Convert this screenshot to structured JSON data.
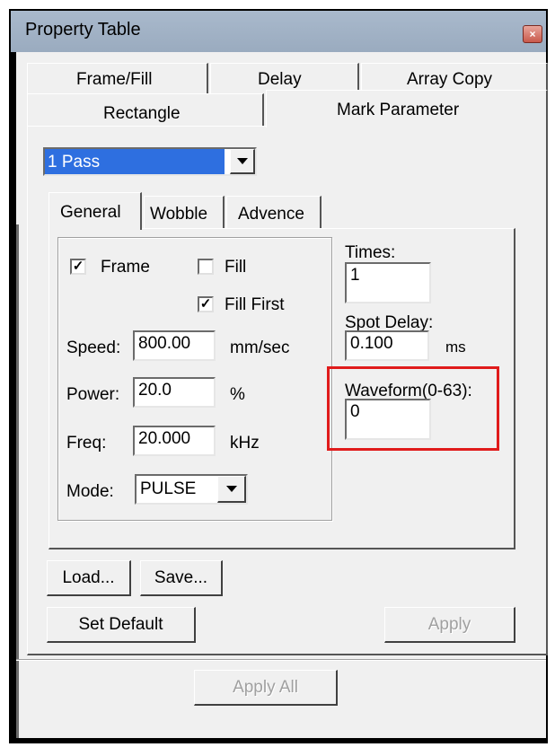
{
  "window": {
    "title": "Property Table",
    "close_glyph": "×"
  },
  "tabs_row1": [
    "Frame/Fill",
    "Delay",
    "Array Copy"
  ],
  "tabs_row2": [
    "Rectangle",
    "Mark Parameter"
  ],
  "pass_select": {
    "value": "1 Pass"
  },
  "inner_tabs": [
    "General",
    "Wobble",
    "Advence"
  ],
  "general": {
    "frame": {
      "label": "Frame",
      "checked": true
    },
    "fill": {
      "label": "Fill",
      "checked": false
    },
    "fill_first": {
      "label": "Fill First",
      "checked": true
    },
    "speed": {
      "label": "Speed:",
      "value": "800.00",
      "unit": "mm/sec"
    },
    "power": {
      "label": "Power:",
      "value": "20.0",
      "unit": "%"
    },
    "freq": {
      "label": "Freq:",
      "value": "20.000",
      "unit": "kHz"
    },
    "mode": {
      "label": "Mode:",
      "value": "PULSE"
    }
  },
  "side": {
    "times": {
      "label": "Times:",
      "value": "1"
    },
    "spot_delay": {
      "label": "Spot Delay:",
      "value": "0.100",
      "unit": "ms"
    },
    "waveform": {
      "label": "Waveform(0-63):",
      "value": "0"
    }
  },
  "buttons": {
    "load": "Load...",
    "save": "Save...",
    "set_default": "Set Default",
    "apply": "Apply",
    "apply_all": "Apply All"
  },
  "check_glyph": "✓",
  "colors": {
    "selection": "#2e6fe0",
    "highlight": "#e01b1b"
  }
}
